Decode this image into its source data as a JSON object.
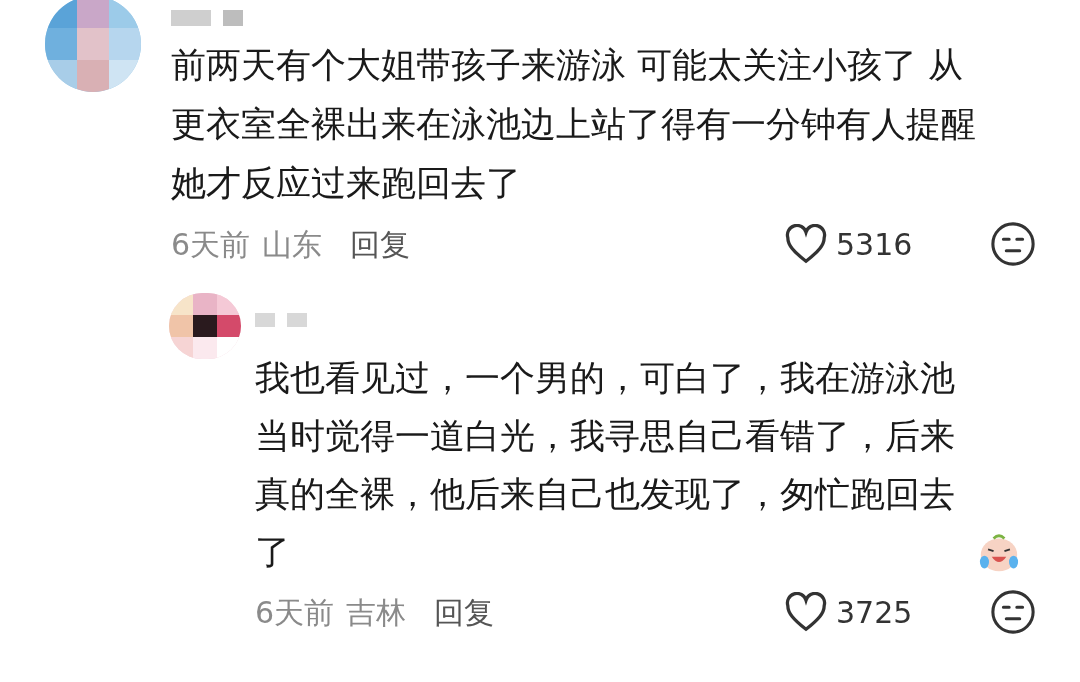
{
  "comments": [
    {
      "text": "前两天有个大姐带孩子来游泳 可能太关注小孩了 从更衣室全裸出来在泳池边上站了得有一分钟有人提醒她才反应过来跑回去了",
      "time": "6天前",
      "location": "山东",
      "reply_label": "回复",
      "likes": "5316",
      "replies": [
        {
          "text": "我也看见过，一个男的，可白了，我在游泳池当时觉得一道白光，我寻思自己看错了，后来真的全裸，他后来自己也发现了，匆忙跑回去了",
          "time": "6天前",
          "location": "吉林",
          "reply_label": "回复",
          "likes": "3725"
        }
      ]
    }
  ]
}
